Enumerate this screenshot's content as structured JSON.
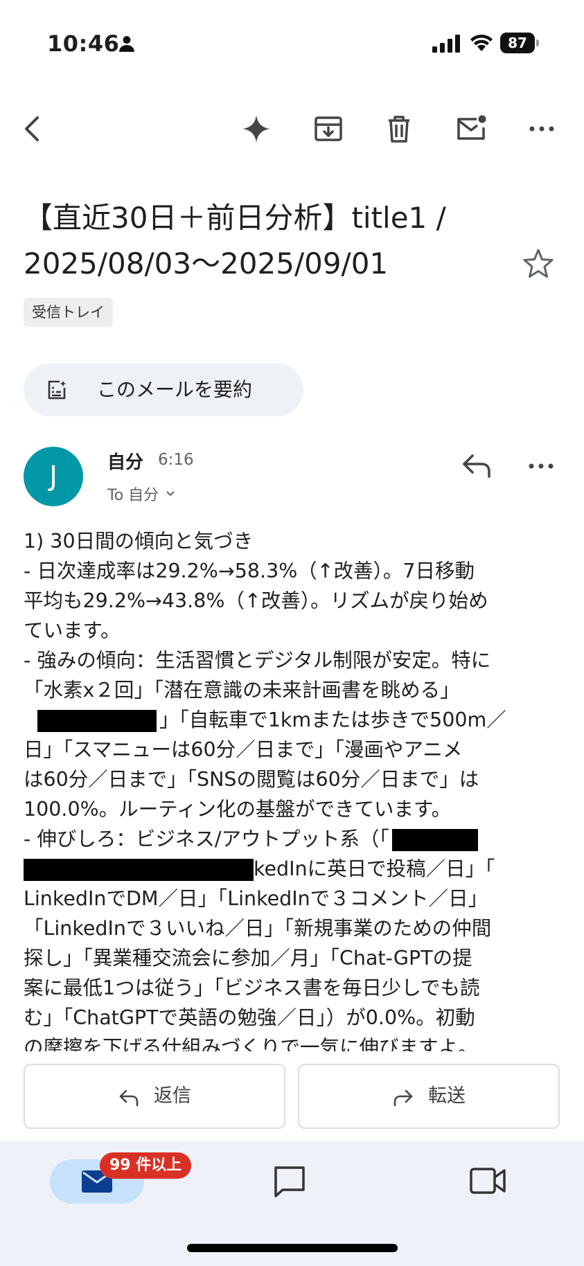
{
  "status_bar": {
    "time": "10:46",
    "battery": "87"
  },
  "email": {
    "subject": "【直近30日＋前日分析】title1 / 2025/08/03〜2025/09/01",
    "label": "受信トレイ",
    "summarize_label": "このメールを要約",
    "sender": {
      "initial": "J",
      "name": "自分",
      "time": "6:16",
      "recipient": "To 自分"
    },
    "body_lines": [
      "1) 30日間の傾向と気づき",
      "- 日次達成率は29.2%→58.3%（↑改善）。7日移動",
      "平均も29.2%→43.8%（↑改善）。リズムが戻り始め",
      "ています。",
      "- 強みの傾向：生活習慣とデジタル制限が安定。特に",
      "「水素x２回」「潜在意識の未来計画書を眺める」",
      "」「自転車で1kmまたは歩きで500m／",
      "日」「スマニューは60分／日まで」「漫画やアニメ",
      "は60分／日まで」「SNSの閲覧は60分／日まで」は",
      "100.0%。ルーティン化の基盤ができています。",
      "- 伸びしろ：ビジネス/アウトプット系（「",
      "kedInに英日で投稿／日」「",
      "LinkedInでDM／日」「LinkedInで３コメント／日」",
      "「LinkedInで３いいね／日」「新規事業のための仲間",
      "探し」「異業種交流会に参加／月」「Chat-GPTの提",
      "案に最低1つは従う」「ビジネス書を毎日少しでも読",
      "む」「ChatGPTで英語の勉強／日」）が0.0%。初動",
      "の摩擦を下げる仕組みづくりで一気に伸びますよ。"
    ]
  },
  "actions": {
    "reply_label": "返信",
    "forward_label": "転送"
  },
  "bottom_nav": {
    "mail_badge": "99 件以上"
  },
  "colors": {
    "avatar": "#0097a7",
    "badge": "#d93025",
    "nav_active": "#c7e1fb",
    "nav_bg": "#eef2f8"
  }
}
